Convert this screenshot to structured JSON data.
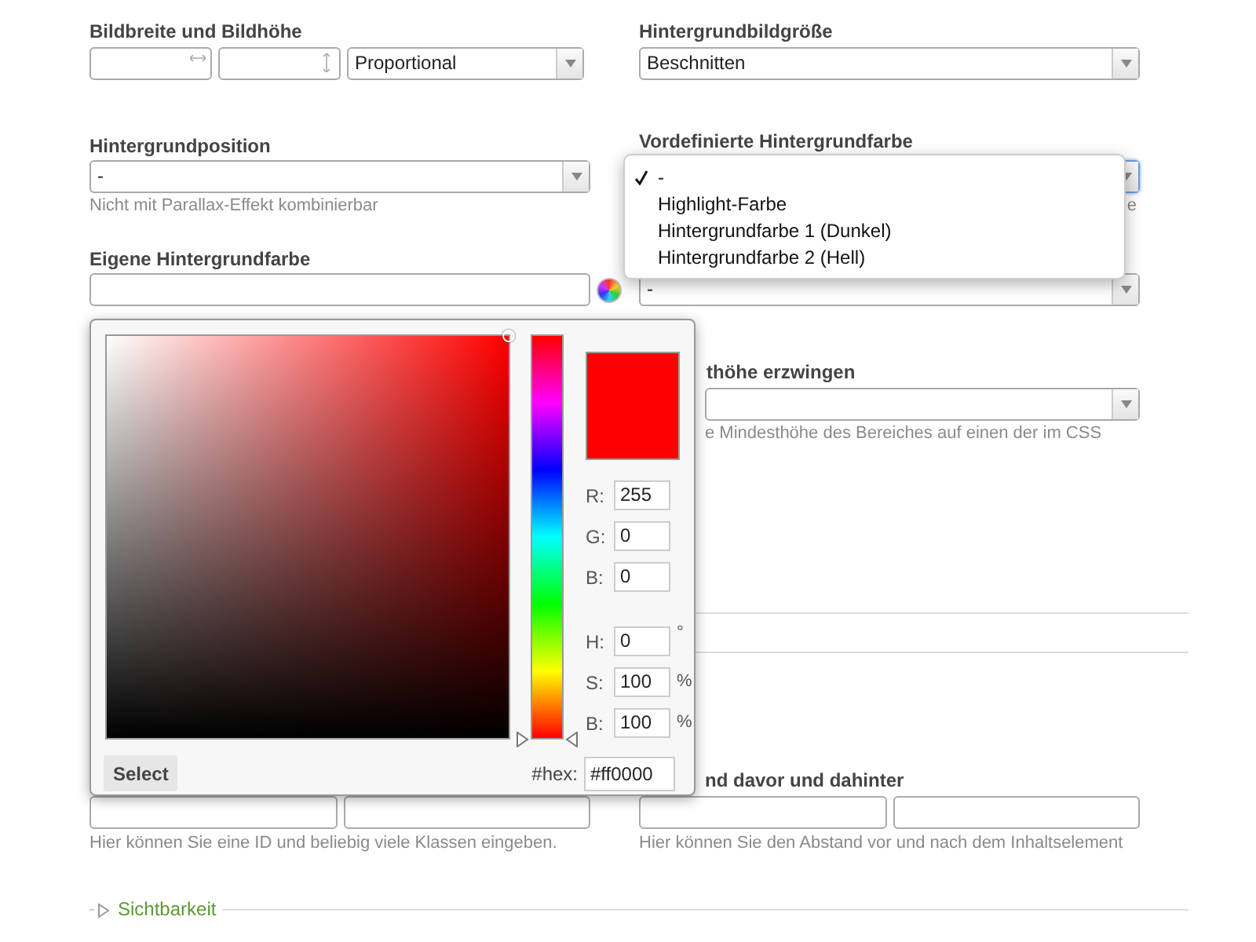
{
  "left": {
    "image_size": {
      "label": "Bildbreite und Bildhöhe",
      "mode": "Proportional"
    },
    "background_position": {
      "label": "Hintergrundposition",
      "value": "-",
      "hint": "Nicht mit Parallax-Effekt kombinierbar"
    },
    "custom_color": {
      "label": "Eigene Hintergrundfarbe"
    },
    "id_class": {
      "hint": "Hier können Sie eine ID und beliebig viele Klassen eingeben."
    }
  },
  "right": {
    "background_size": {
      "label": "Hintergrundbildgröße",
      "value": "Beschnitten"
    },
    "predefined_color": {
      "label": "Vordefinierte Hintergrundfarbe",
      "hint": "e"
    },
    "select_3": {
      "value": "-"
    },
    "min_height": {
      "label": "thöhe erzwingen",
      "hint": "e Mindesthöhe des Bereiches auf einen der im CSS"
    },
    "spacing": {
      "label": "nd davor und dahinter",
      "hint": "Hier können Sie den Abstand vor und nach dem Inhaltselement"
    }
  },
  "section": {
    "label": "Sichtbarkeit",
    "expanded": false
  },
  "dropdown": {
    "options": [
      {
        "label": "-",
        "selected": true
      },
      {
        "label": "Highlight-Farbe",
        "selected": false
      },
      {
        "label": "Hintergrundfarbe 1 (Dunkel)",
        "selected": false
      },
      {
        "label": "Hintergrundfarbe 2 (Hell)",
        "selected": false
      }
    ]
  },
  "color_picker": {
    "fields": [
      {
        "label": "R:",
        "value": "255"
      },
      {
        "label": "G:",
        "value": "0"
      },
      {
        "label": "B:",
        "value": "0"
      },
      {
        "label": "H:",
        "value": "0",
        "unit": "°"
      },
      {
        "label": "S:",
        "value": "100",
        "unit": "%"
      },
      {
        "label": "B:",
        "value": "100",
        "unit": "%"
      }
    ],
    "hue_slider": {
      "level": 0
    },
    "hex_label": "#hex:",
    "hex": "#ff0000",
    "select_button": "Select"
  }
}
